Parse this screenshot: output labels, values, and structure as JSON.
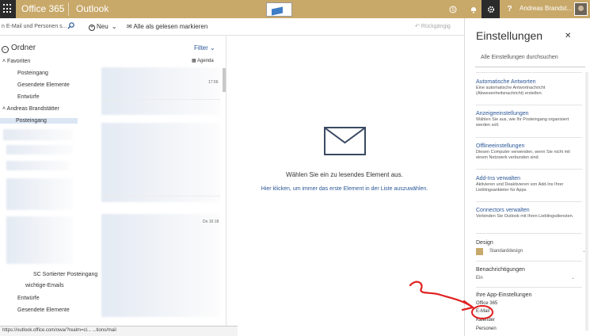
{
  "suite": {
    "brand": "Office 365",
    "app": "Outlook",
    "user": "Andreas Brandst...",
    "help": "?"
  },
  "command": {
    "search_placeholder": "n E-Mail und Personen s...",
    "new_label": "Neu",
    "mark_read_label": "Alle als gelesen markieren",
    "undo_label": "Rückgängig"
  },
  "folders": {
    "title": "Ordner",
    "favorites_label": "Favoriten",
    "favorites": [
      "Posteingang",
      "Gesendete Elemente",
      "Entwürfe"
    ],
    "account_label": "Andreas Brandstätter",
    "selected": "Posteingang",
    "lower": [
      "SC Sortierter Posteingang",
      "wichtige-Emails",
      "Entwürfe",
      "Gesendete Elemente"
    ]
  },
  "list": {
    "filter_label": "Filter",
    "agenda_label": "Agenda",
    "time1": "17:56",
    "time2": "Do 16:18"
  },
  "reading": {
    "message": "Wählen Sie ein zu lesendes Element aus.",
    "link": "Hier klicken, um immer das erste Element in der Liste auszuwählen."
  },
  "status_url": "https://outlook.office.com/owa/?realm=cl... ...tions/mail",
  "settings": {
    "title": "Einstellungen",
    "search_placeholder": "Alle Einstellungen durchsuchen",
    "items": [
      {
        "heading": "Automatische Antworten",
        "desc": "Eine automatische Antwortnachricht (Abwesenheitsnachricht) erstellen."
      },
      {
        "heading": "Anzeigeeinstellungen",
        "desc": "Wählen Sie aus, wie Ihr Posteingang organisiert werden soll."
      },
      {
        "heading": "Offlineeinstellungen",
        "desc": "Diesen Computer verwenden, wenn Sie nicht mit einem Netzwerk verbunden sind."
      },
      {
        "heading": "Add-Ins verwalten",
        "desc": "Aktivieren und Deaktivieren von Add-Ins Ihrer Lieblingsanbieter für Apps."
      },
      {
        "heading": "Connectors verwalten",
        "desc": "Verbinden Sie Outlook mit Ihren Lieblingsdiensten."
      }
    ],
    "design_label": "Design",
    "design_value": "Standarddesign",
    "notifications_label": "Benachrichtigungen",
    "notifications_value": "Ein",
    "app_settings_label": "Ihre App-Einstellungen",
    "app_settings": [
      "Office 365",
      "E-Mail",
      "Kalender",
      "Personen"
    ]
  },
  "colors": {
    "suite": "#c8a96a",
    "link": "#2b5797",
    "annotation": "#e02020"
  }
}
